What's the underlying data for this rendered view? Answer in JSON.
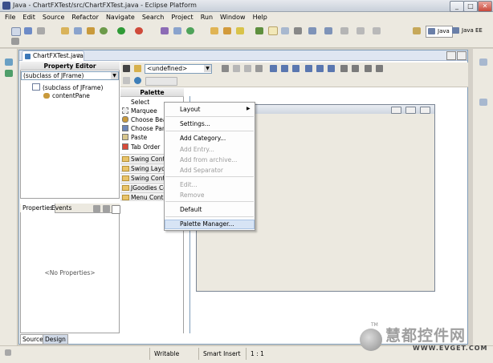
{
  "window": {
    "title": "Java - ChartFXTest/src/ChartFXTest.java - Eclipse Platform",
    "minimize": "_",
    "maximize": "□",
    "close": "✕"
  },
  "menu": [
    "File",
    "Edit",
    "Source",
    "Refactor",
    "Navigate",
    "Search",
    "Project",
    "Run",
    "Window",
    "Help"
  ],
  "perspectives": [
    {
      "label": "Java",
      "icon": "java-perspective-icon"
    },
    {
      "label": "Java EE",
      "icon": "javaee-perspective-icon"
    }
  ],
  "editor": {
    "tab_title": "ChartFXTest.java",
    "tab_close": "⊗"
  },
  "property_editor": {
    "title": "Property Editor",
    "selector": "(subclass of JFrame)",
    "tree": [
      {
        "label": "(subclass of JFrame)",
        "icon": "jframe-icon"
      },
      {
        "label": "contentPane",
        "icon": "bean-icon"
      }
    ]
  },
  "properties_view": {
    "tabs": [
      "Properties",
      "Events"
    ],
    "empty_text": "<No Properties>"
  },
  "editor_bottom_tabs": [
    "Source",
    "Design"
  ],
  "toolbar": {
    "combo_value": "<undefined>"
  },
  "palette": {
    "title": "Palette",
    "items": [
      "Select",
      "Marquee",
      "Choose Bean",
      "Choose Pane",
      "Paste",
      "Tab Order"
    ],
    "drawers": [
      "Swing Containers",
      "Swing Layouts",
      "Swing Controls",
      "JGoodies Controls",
      "Menu Controls"
    ]
  },
  "context_menu": {
    "items": [
      {
        "label": "Layout",
        "enabled": true,
        "submenu": true
      },
      {
        "label": "Settings...",
        "enabled": true
      },
      {
        "label": "Add Category...",
        "enabled": true
      },
      {
        "label": "Add Entry...",
        "enabled": false
      },
      {
        "label": "Add from archive...",
        "enabled": false
      },
      {
        "label": "Add Separator",
        "enabled": false
      },
      {
        "label": "Edit...",
        "enabled": false
      },
      {
        "label": "Remove",
        "enabled": false
      },
      {
        "label": "Default",
        "enabled": true
      },
      {
        "label": "Palette Manager...",
        "enabled": true,
        "highlighted": true
      }
    ],
    "submenu_arrow": "▶"
  },
  "status_bar": {
    "mode": "Writable",
    "insert": "Smart Insert",
    "position": "1 : 1"
  },
  "watermark": {
    "text": "慧都控件网",
    "site": "WWW.EVGET.COM",
    "tm": "TM"
  },
  "colors": {
    "accent": "#7f9db9",
    "highlight": "#d7e4f5",
    "background": "#ece9e0"
  }
}
